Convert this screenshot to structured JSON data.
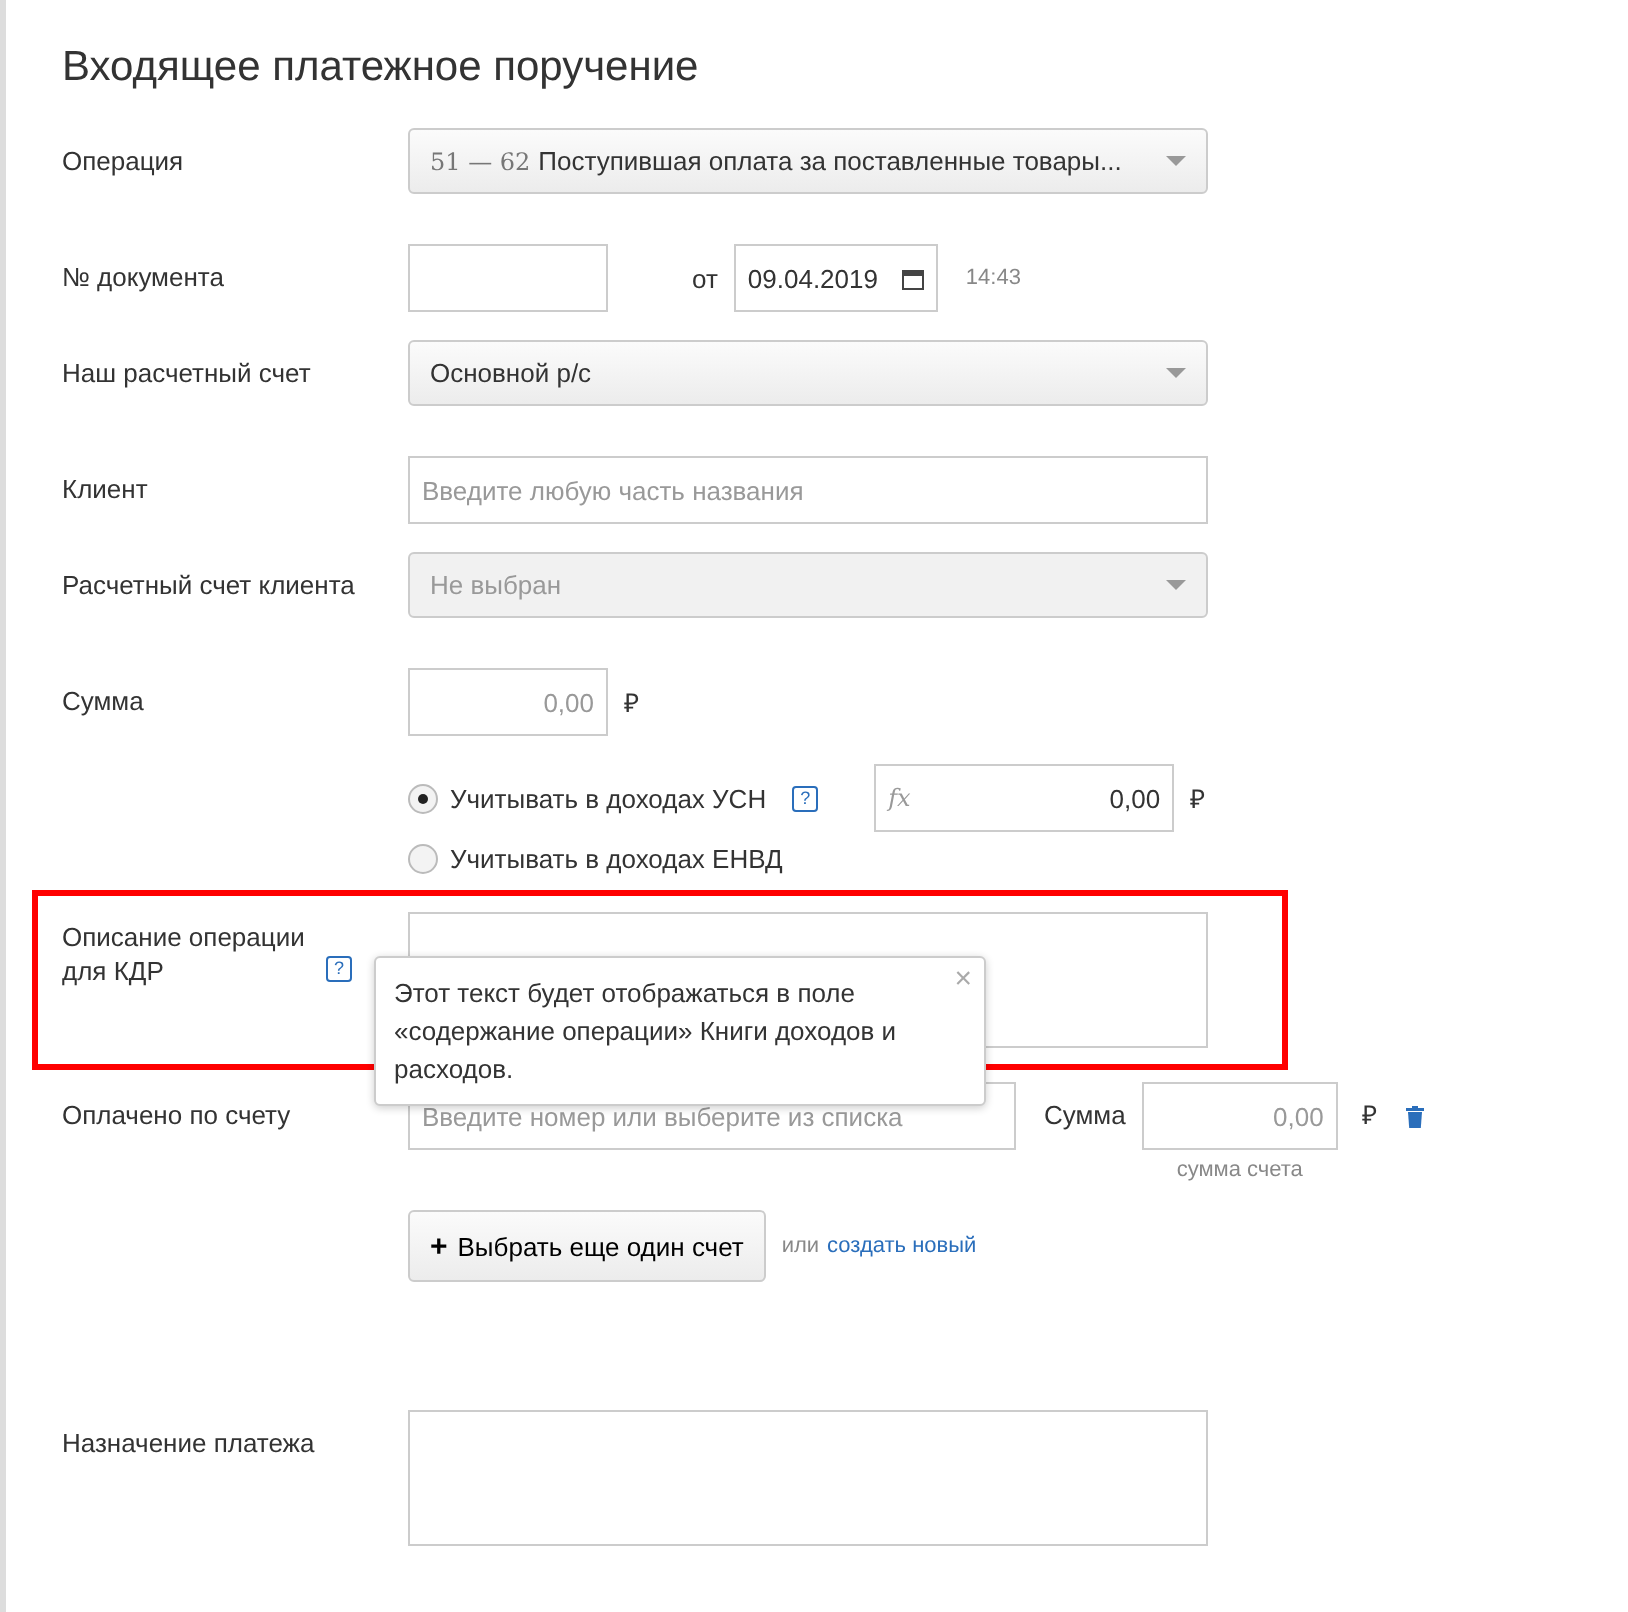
{
  "title": "Входящее платежное поручение",
  "operation": {
    "label": "Операция",
    "code": "51 — 62",
    "value": "Поступившая оплата за поставленные товары..."
  },
  "document": {
    "label": "№ документа",
    "date_prefix": "от",
    "date": "09.04.2019",
    "time": "14:43"
  },
  "our_account": {
    "label": "Наш расчетный счет",
    "value": "Основной р/с",
    "disabled": false
  },
  "client": {
    "label": "Клиент",
    "placeholder": "Введите любую часть названия"
  },
  "client_account": {
    "label": "Расчетный счет клиента",
    "placeholder": "Не выбран",
    "disabled": true
  },
  "sum": {
    "label": "Сумма",
    "placeholder": "0,00",
    "currency": "₽"
  },
  "tax_options": [
    {
      "label": "Учитывать в доходах УСН",
      "selected": true,
      "help": "?",
      "formula": "fx",
      "amount": "0,00",
      "currency": "₽"
    },
    {
      "label": "Учитывать в доходах ЕНВД",
      "selected": false
    }
  ],
  "kdr_description": {
    "label": "Описание операции для КДР",
    "help": "?",
    "highlighted": true,
    "tooltip": {
      "text": "Этот текст будет отображаться в поле «содержание операции» Книги доходов и расходов.",
      "close": "×"
    }
  },
  "paid_by_invoice": {
    "label": "Оплачено по счету",
    "placeholder": "Введите номер или выберите из списка",
    "sum_label": "Сумма",
    "sum_placeholder": "0,00",
    "currency": "₽",
    "sum_hint": "сумма счета"
  },
  "add_invoice": {
    "button": "Выбрать еще один счет",
    "button_icon": "+",
    "or": "или",
    "link": "создать новый"
  },
  "purpose": {
    "label": "Назначение платежа"
  }
}
